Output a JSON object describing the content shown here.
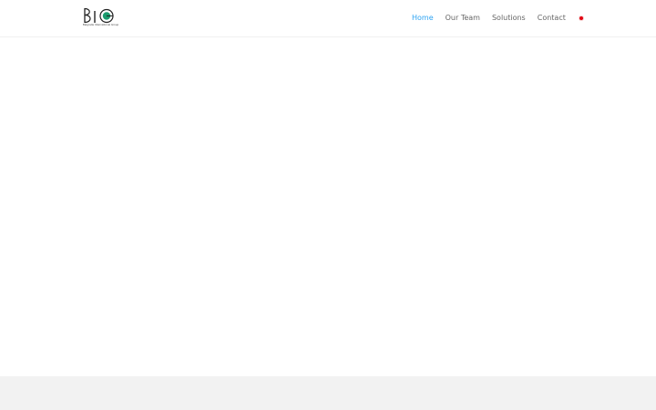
{
  "header": {
    "logo": {
      "mark_text": "BIG",
      "caption": "Belgrade International Group",
      "accent_color": "#1a9b6e"
    },
    "nav": {
      "items": [
        {
          "label": "Home",
          "active": true
        },
        {
          "label": "Our Team",
          "active": false
        },
        {
          "label": "Solutions",
          "active": false
        },
        {
          "label": "Contact",
          "active": false
        }
      ],
      "active_color": "#2ea3f2",
      "language_icon": "flag-icon"
    }
  },
  "footer": {
    "background": "#f2f2f2"
  }
}
